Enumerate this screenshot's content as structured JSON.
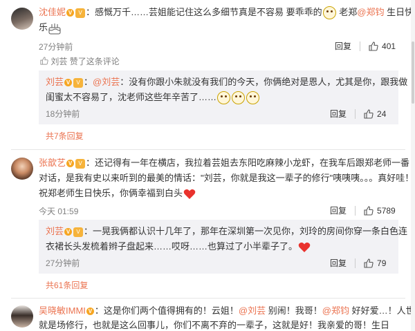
{
  "comments": [
    {
      "author": "沈佳妮",
      "line1_text": "：感慨万千……芸姐能记住这么多细节真是不容易 要乖乖的",
      "line1_after": "老郑",
      "mention1": "@郑钧",
      "line1_end": "生日快",
      "line2_text": "乐",
      "time": "27分钟前",
      "reply_label": "回复",
      "likes": "401",
      "liked_by_name": "刘芸",
      "liked_by_text": "赞了这条评论",
      "reply": {
        "author": "刘芸",
        "mention": "@刘芸",
        "line1_text": "：",
        "line1_rest": "没有你跟小朱就没有我们的今天，你俩绝对是恩人，尤其是你，跟我做",
        "line2_text": "闺蜜太不容易了，沈老师这些年辛苦了……",
        "time": "18分钟前",
        "reply_label": "回复",
        "likes": "24"
      },
      "more_replies": "共7条回复"
    },
    {
      "author": "张歆艺",
      "line1_text": "：还记得有一年在横店，我拉着芸姐去东阳吃麻辣小龙虾，在我车后跟郑老师一番",
      "line2_text": "对话，是我有史以来听到的最美的情话：\"刘芸，你就是我这一辈子的修行\"咦咦咦。。。真好哇！",
      "line3_text": "祝郑老师生日快乐，你俩幸福到白头",
      "time": "今天 01:59",
      "reply_label": "回复",
      "likes": "5789",
      "reply": {
        "author": "刘芸",
        "line1_text": "：一晃我俩都认识十几年了，那年在深圳第一次见你，刘玲的房间你穿一条白色连",
        "line2_text": "衣裙长头发梳着辫子盘起来……哎呀……也算过了小半辈子了。",
        "time": "27分钟前",
        "reply_label": "回复",
        "likes": "79"
      },
      "more_replies": "共61条回复"
    },
    {
      "author": "吴晓敏IMMI",
      "line1_text": "：这是你们两个值得拥有的！云姐！",
      "mention1": "@刘芸",
      "line1_mid": "别闹！我哥！",
      "mention2": "@郑钧",
      "line1_end": "好好爱…！人世间",
      "line2_text": "就是场修行，也就是这么回事儿，你们不离不弃的一辈子，这就是好！我亲爱的哥！生日"
    }
  ],
  "colors": {
    "accent": "#eb7350",
    "reply_bg": "#f2f2f5",
    "muted": "#808080"
  },
  "icons": [
    "thumb-up-icon",
    "vip-badge-icon",
    "level-badge-icon",
    "smile-emoji-icon",
    "heart-emoji-icon",
    "cake-emoji-icon"
  ]
}
